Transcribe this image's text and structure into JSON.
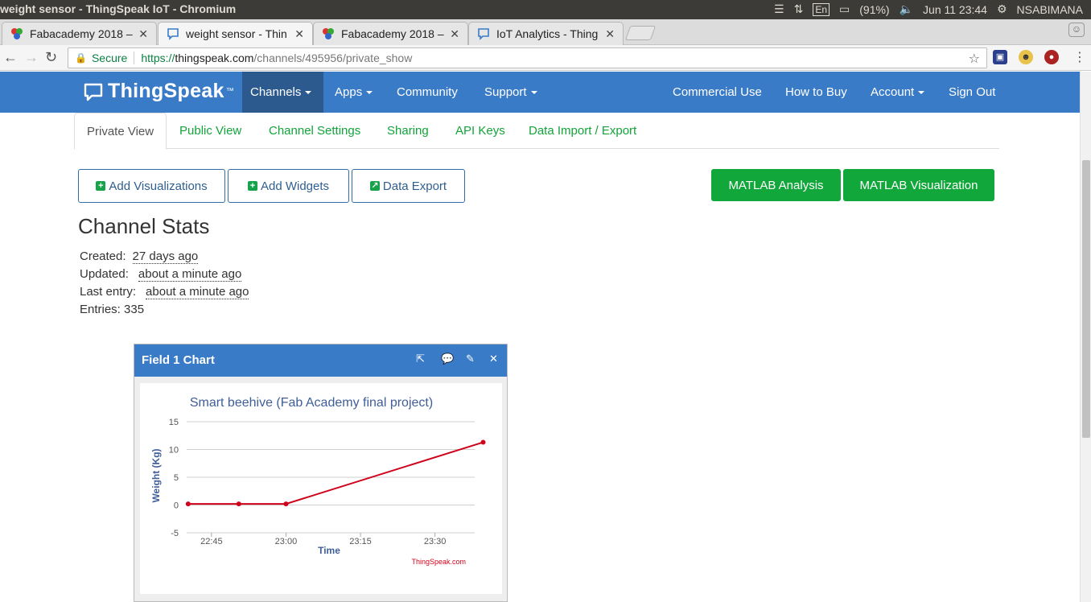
{
  "os": {
    "window_title": "weight sensor - ThingSpeak IoT - Chromium",
    "keyboard": "En",
    "battery": "(91%)",
    "datetime": "Jun 11 23:44",
    "user": "NSABIMANA"
  },
  "browser": {
    "tabs": [
      {
        "title": "Fabacademy 2018 –",
        "active": false
      },
      {
        "title": "weight sensor - Thin",
        "active": true
      },
      {
        "title": "Fabacademy 2018 –",
        "active": false
      },
      {
        "title": "IoT Analytics - Thing",
        "active": false
      }
    ],
    "secure_label": "Secure",
    "url_protocol": "https://",
    "url_host": "thingspeak.com",
    "url_path": "/channels/495956/private_show"
  },
  "nav": {
    "logo": "ThingSpeak",
    "logo_tm": "™",
    "items": [
      "Channels",
      "Apps",
      "Community",
      "Support"
    ],
    "right_items": [
      "Commercial Use",
      "How to Buy",
      "Account",
      "Sign Out"
    ]
  },
  "channel_tabs": [
    "Private View",
    "Public View",
    "Channel Settings",
    "Sharing",
    "API Keys",
    "Data Import / Export"
  ],
  "actions": {
    "add_visualizations": "Add Visualizations",
    "add_widgets": "Add Widgets",
    "data_export": "Data Export",
    "matlab_analysis": "MATLAB Analysis",
    "matlab_visualization": "MATLAB Visualization"
  },
  "stats": {
    "title": "Channel Stats",
    "created_label": "Created:",
    "created_value": "27 days ago",
    "updated_label": "Updated:",
    "updated_value": "about a minute ago",
    "last_entry_label": "Last entry:",
    "last_entry_value": "about a minute ago",
    "entries_label": "Entries:",
    "entries_value": "335"
  },
  "widget": {
    "title": "Field 1 Chart"
  },
  "chart_data": {
    "type": "line",
    "title": "Smart beehive (Fab Academy final project)",
    "xlabel": "Time",
    "ylabel": "Weight (Kg)",
    "ylim": [
      -5,
      15
    ],
    "yticks": [
      -5,
      0,
      5,
      10,
      15
    ],
    "xtick_labels": [
      "22:45",
      "23:00",
      "23:15",
      "23:30"
    ],
    "xtick_minutes": [
      45,
      60,
      75,
      90
    ],
    "xlim_minutes": [
      40,
      98
    ],
    "series": [
      {
        "color": "#d0021b",
        "x_minutes": [
          40.3,
          50.5,
          60.0,
          99.7
        ],
        "values": [
          0.2,
          0.2,
          0.2,
          11.3
        ]
      }
    ],
    "credit": "ThingSpeak.com",
    "grid": true
  }
}
